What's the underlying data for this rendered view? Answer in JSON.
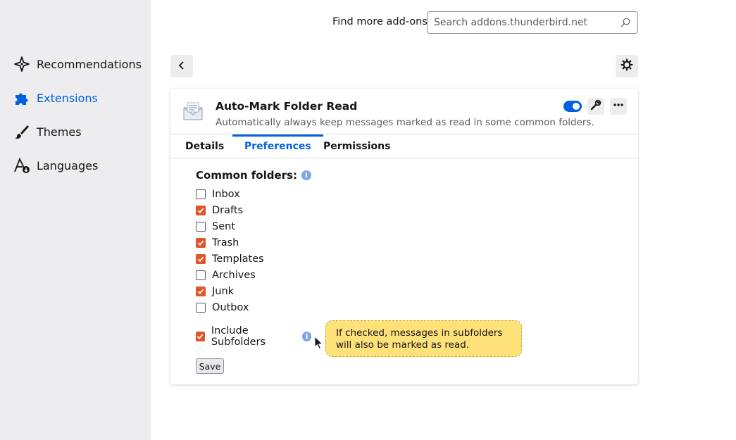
{
  "sidebar": {
    "items": [
      {
        "label": "Recommendations",
        "icon": "recommendations-sparkle-icon"
      },
      {
        "label": "Extensions",
        "icon": "puzzle-piece-icon",
        "active": true
      },
      {
        "label": "Themes",
        "icon": "paintbrush-icon"
      },
      {
        "label": "Languages",
        "icon": "language-icon"
      }
    ]
  },
  "header": {
    "find_label": "Find more add-ons",
    "search_placeholder": "Search addons.thunderbird.net"
  },
  "addon": {
    "name": "Auto-Mark Folder Read",
    "description": "Automatically always keep messages marked as read in some common folders.",
    "enabled": true,
    "tabs": [
      {
        "label": "Details"
      },
      {
        "label": "Preferences",
        "active": true
      },
      {
        "label": "Permissions"
      }
    ]
  },
  "prefs": {
    "heading": "Common folders:",
    "folders": [
      {
        "label": "Inbox",
        "checked": false
      },
      {
        "label": "Drafts",
        "checked": true
      },
      {
        "label": "Sent",
        "checked": false
      },
      {
        "label": "Trash",
        "checked": true
      },
      {
        "label": "Templates",
        "checked": true
      },
      {
        "label": "Archives",
        "checked": false
      },
      {
        "label": "Junk",
        "checked": true
      },
      {
        "label": "Outbox",
        "checked": false
      }
    ],
    "subfolders_label": "Include Subfolders",
    "subfolders_checked": true,
    "tooltip_line1": "If checked, messages in subfolders",
    "tooltip_line2": "will also be marked as read.",
    "save_label": "Save"
  },
  "colors": {
    "accent": "#0061e0",
    "checkbox": "#e0562b",
    "tooltip": "#ffe17a",
    "sidebar": "#ededf0"
  }
}
